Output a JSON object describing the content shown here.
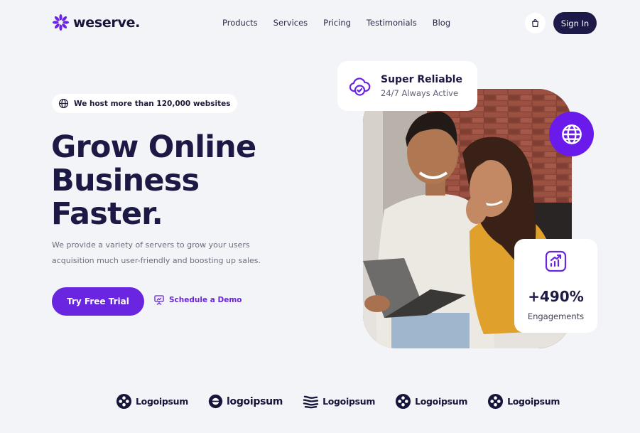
{
  "brand": {
    "name": "weserve.",
    "accent": "#6a25e0",
    "dark": "#1d1a4a"
  },
  "nav": {
    "links": [
      "Products",
      "Services",
      "Pricing",
      "Testimonials",
      "Blog"
    ],
    "cart_icon": "shopping-bag-icon",
    "signin_label": "Sign In"
  },
  "hero": {
    "badge": "We host more than 120,000 websites",
    "title_lines": [
      "Grow Online",
      "Business",
      "Faster."
    ],
    "subtitle_line1": "We provide a variety of servers to grow your users",
    "subtitle_line2": "acquisition much user-friendly and boosting up sales.",
    "cta_primary": "Try Free Trial",
    "cta_secondary": "Schedule a Demo"
  },
  "cards": {
    "reliable": {
      "title": "Super Reliable",
      "subtitle": "24/7 Always Active",
      "icon": "cloud-check-icon"
    },
    "engagement": {
      "value": "+490%",
      "label": "Engagements",
      "icon": "chart-up-icon"
    },
    "globe_icon": "globe-icon"
  },
  "partners": [
    "Logoipsum",
    "logoipsum",
    "Logoipsum",
    "Logoipsum",
    "Logoipsum"
  ]
}
